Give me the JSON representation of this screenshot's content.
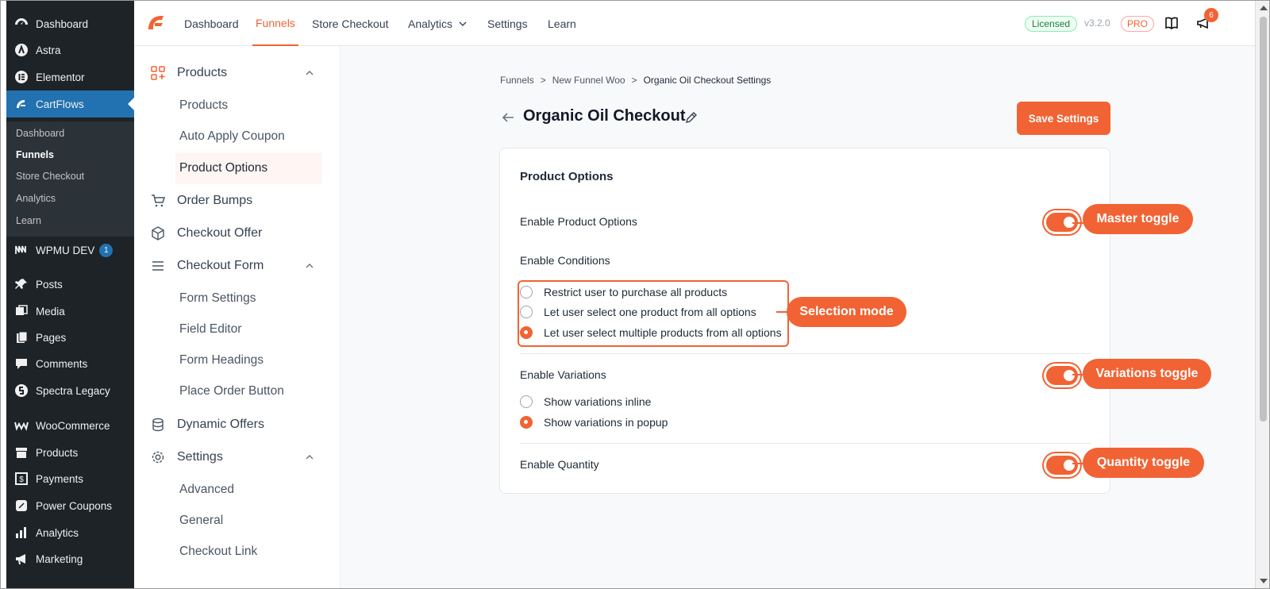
{
  "wp_menu": {
    "items": [
      {
        "label": "Dashboard",
        "icon": "dashboard-icon"
      },
      {
        "label": "Astra",
        "icon": "astra-icon"
      },
      {
        "label": "Elementor",
        "icon": "elementor-icon"
      },
      {
        "label": "CartFlows",
        "icon": "cartflows-icon"
      },
      {
        "label": "WPMU DEV",
        "icon": "wpmudev-icon",
        "badge": "1"
      },
      {
        "label": "Posts",
        "icon": "pin-icon"
      },
      {
        "label": "Media",
        "icon": "media-icon"
      },
      {
        "label": "Pages",
        "icon": "pages-icon"
      },
      {
        "label": "Comments",
        "icon": "comments-icon"
      },
      {
        "label": "Spectra Legacy",
        "icon": "spectra-icon"
      },
      {
        "label": "WooCommerce",
        "icon": "woocommerce-icon"
      },
      {
        "label": "Products",
        "icon": "products-box-icon"
      },
      {
        "label": "Payments",
        "icon": "payments-icon"
      },
      {
        "label": "Power Coupons",
        "icon": "coupons-icon"
      },
      {
        "label": "Analytics",
        "icon": "analytics-bars-icon"
      },
      {
        "label": "Marketing",
        "icon": "megaphone-icon"
      }
    ],
    "submenu": [
      "Dashboard",
      "Funnels",
      "Store Checkout",
      "Analytics",
      "Learn"
    ]
  },
  "topnav": {
    "items": [
      "Dashboard",
      "Funnels",
      "Store Checkout",
      "Analytics",
      "Settings",
      "Learn"
    ],
    "licensed": "Licensed",
    "version": "v3.2.0",
    "pro": "PRO",
    "notifications": "6"
  },
  "settings_nav": {
    "products": "Products",
    "products_sub": [
      "Products",
      "Auto Apply Coupon",
      "Product Options"
    ],
    "order_bumps": "Order Bumps",
    "checkout_offer": "Checkout Offer",
    "checkout_form": "Checkout Form",
    "checkout_form_sub": [
      "Form Settings",
      "Field Editor",
      "Form Headings",
      "Place Order Button"
    ],
    "dynamic_offers": "Dynamic Offers",
    "settings": "Settings",
    "settings_sub": [
      "Advanced",
      "General",
      "Checkout Link"
    ]
  },
  "breadcrumb": [
    "Funnels",
    "New Funnel Woo",
    "Organic Oil Checkout Settings"
  ],
  "breadcrumb_sep": ">",
  "page_title": "Organic Oil Checkout",
  "save_label": "Save Settings",
  "card": {
    "title": "Product Options",
    "enable_product_options": "Enable Product Options",
    "enable_conditions": "Enable Conditions",
    "conditions": [
      {
        "label": "Restrict user to purchase all products",
        "selected": false
      },
      {
        "label": "Let user select one product from all options",
        "selected": false
      },
      {
        "label": "Let user select multiple products from all options",
        "selected": true
      }
    ],
    "enable_variations": "Enable Variations",
    "variations": [
      {
        "label": "Show variations inline",
        "selected": false
      },
      {
        "label": "Show variations in popup",
        "selected": true
      }
    ],
    "enable_quantity": "Enable Quantity"
  },
  "callouts": {
    "master": "Master toggle",
    "selection": "Selection mode",
    "variations": "Variations toggle",
    "quantity": "Quantity toggle"
  },
  "colors": {
    "accent": "#f16334",
    "wp_sidebar": "#1d2327",
    "wp_active": "#2271b1"
  }
}
